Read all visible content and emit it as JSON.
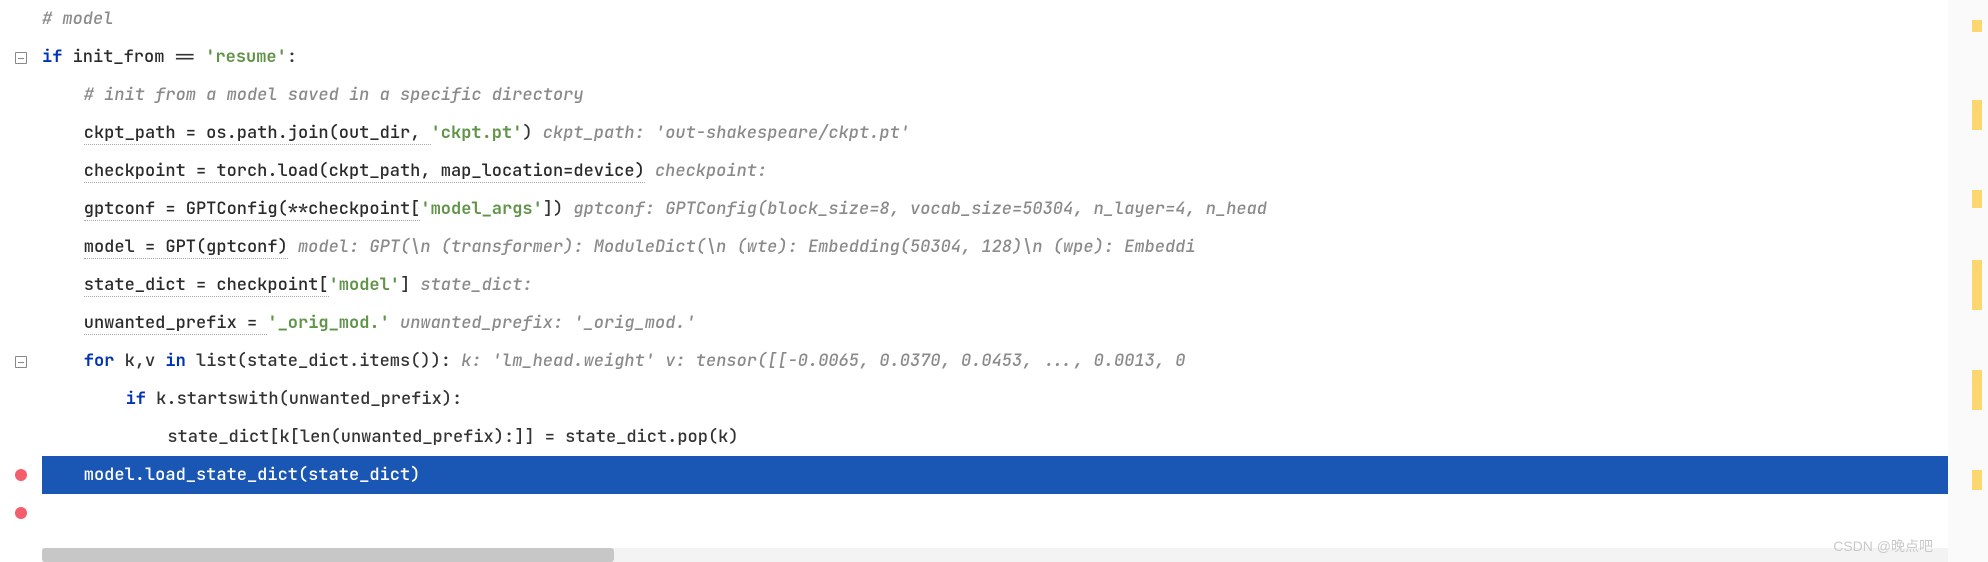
{
  "gutter": {
    "fold_lines": [
      1,
      10
    ],
    "breakpoint_lines": [
      12,
      13
    ]
  },
  "watermark": "CSDN @晚点吧",
  "lines": {
    "l0": {
      "comment": "# model"
    },
    "l1": {
      "code_start": "if",
      "var": " init_from ",
      "op": "== ",
      "str": "'resume'",
      "end": ":"
    },
    "l2": {
      "comment": "# init from a model saved in a specific directory"
    },
    "l3": {
      "code": "ckpt_path = os.path.join(out_dir, ",
      "str": "'ckpt.pt'",
      "code2": ")",
      "hint": "   ckpt_path: 'out-shakespeare/ckpt.pt'"
    },
    "l4": {
      "code": "checkpoint = torch.load(ckpt_path, map_location=device)",
      "hint": "   checkpoint:"
    },
    "l5": {
      "code": "gptconf = GPTConfig(**checkpoint[",
      "str": "'model_args'",
      "code2": "])",
      "hint": "   gptconf: GPTConfig(block_size=8, vocab_size=50304, n_layer=4, n_head"
    },
    "l6": {
      "code": "model = GPT(gptconf)",
      "hint": "   model: GPT(\\n  (transformer): ModuleDict(\\n    (wte): Embedding(50304, 128)\\n    (wpe): Embeddi"
    },
    "l7": {
      "code": "state_dict = checkpoint[",
      "str": "'model'",
      "code2": "]",
      "hint": "   state_dict:"
    },
    "l8": {
      "code": "unwanted_prefix = ",
      "str": "'_orig_mod.'",
      "hint": "   unwanted_prefix: '_orig_mod.'"
    },
    "l9": {
      "kw": "for",
      "code": " k,v ",
      "kw2": "in",
      "code2": " list(state_dict.items()):",
      "hint": "   k: 'lm_head.weight'    v: tensor([[-0.0065,  0.0370,  0.0453,  ...,  0.0013,  0"
    },
    "l10": {
      "kw": "if",
      "code": " k.startswith(unwanted_prefix):"
    },
    "l11": {
      "code": "state_dict[k[len(unwanted_prefix):]] = state_dict.pop(k)"
    },
    "l12": {
      "code": "model.load_state_dict(state_dict)"
    }
  },
  "chart_data": {
    "type": "table",
    "note": "not a chart"
  }
}
